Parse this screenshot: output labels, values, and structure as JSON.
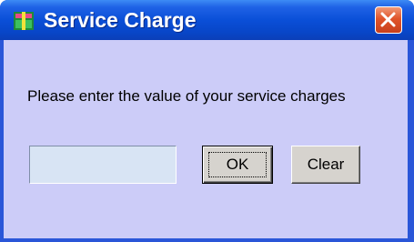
{
  "window": {
    "title": "Service Charge",
    "icon": "app-icon",
    "close_icon": "close-icon"
  },
  "form": {
    "prompt": "Please enter the value of your service charges",
    "input_value": "",
    "ok_label": "OK",
    "clear_label": "Clear"
  },
  "colors": {
    "titlebar": "#0a4fd8",
    "client_background": "#ccccf8",
    "input_background": "#d8e4f4",
    "button_face": "#d6d3ce",
    "close_button": "#e0542a"
  }
}
